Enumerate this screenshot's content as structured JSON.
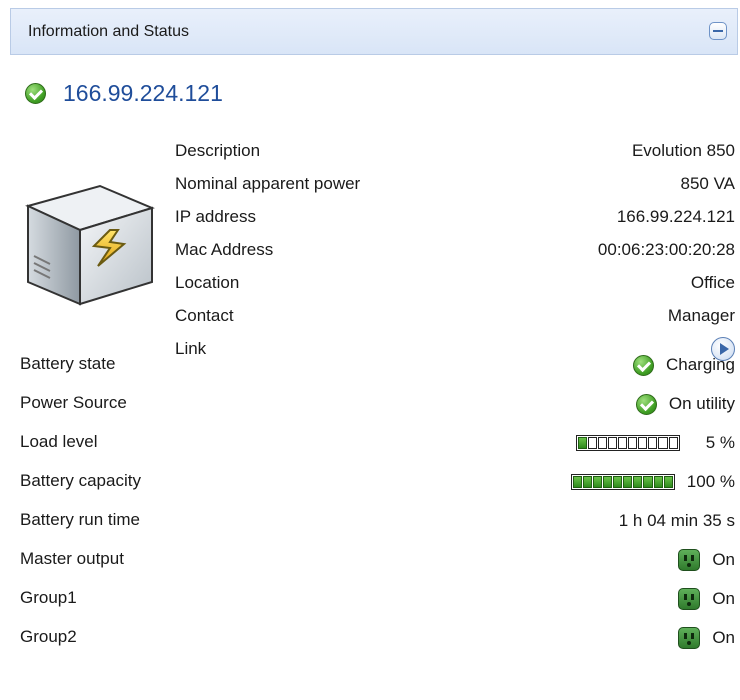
{
  "panel": {
    "title": "Information and Status",
    "collapse_icon": "collapse-minus-icon"
  },
  "host": {
    "status_icon": "check-circle-icon",
    "ip": "166.99.224.121"
  },
  "device_image": "ups-device-icon",
  "details": [
    {
      "label": "Description",
      "value": "Evolution 850"
    },
    {
      "label": "Nominal apparent power",
      "value": "850 VA"
    },
    {
      "label": "IP address",
      "value": "166.99.224.121"
    },
    {
      "label": "Mac Address",
      "value": "00:06:23:00:20:28"
    },
    {
      "label": "Location",
      "value": "Office"
    },
    {
      "label": "Contact",
      "value": "Manager"
    },
    {
      "label": "Link",
      "icon": "play-arrow-icon"
    }
  ],
  "status": {
    "battery_state": {
      "label": "Battery state",
      "value": "Charging",
      "icon": "check-circle-icon"
    },
    "power_source": {
      "label": "Power Source",
      "value": "On utility",
      "icon": "check-circle-icon"
    },
    "load_level": {
      "label": "Load level",
      "value": "5 %",
      "level": 0.05
    },
    "battery_capacity": {
      "label": "Battery capacity",
      "value": "100 %",
      "level": 1.0
    },
    "battery_run_time": {
      "label": "Battery run time",
      "value": "1 h 04 min 35 s"
    },
    "master_output": {
      "label": "Master output",
      "value": "On",
      "icon": "outlet-icon"
    },
    "group1": {
      "label": "Group1",
      "value": "On",
      "icon": "outlet-icon"
    },
    "group2": {
      "label": "Group2",
      "value": "On",
      "icon": "outlet-icon"
    }
  },
  "colors": {
    "accent_blue": "#1f4d9a",
    "ok_green": "#3f9e23",
    "header_bg": "#dfe8f8"
  }
}
